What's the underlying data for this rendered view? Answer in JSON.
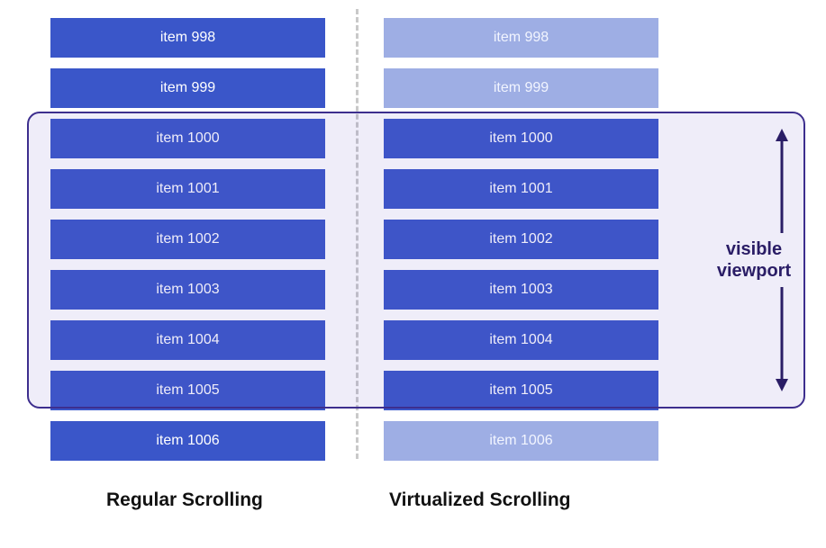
{
  "left_column": {
    "label": "Regular Scrolling",
    "items": [
      {
        "label": "item 998",
        "faded": false
      },
      {
        "label": "item 999",
        "faded": false
      },
      {
        "label": "item 1000",
        "faded": false
      },
      {
        "label": "item 1001",
        "faded": false
      },
      {
        "label": "item 1002",
        "faded": false
      },
      {
        "label": "item 1003",
        "faded": false
      },
      {
        "label": "item 1004",
        "faded": false
      },
      {
        "label": "item 1005",
        "faded": false
      },
      {
        "label": "item 1006",
        "faded": false
      }
    ]
  },
  "right_column": {
    "label": "Virtualized Scrolling",
    "items": [
      {
        "label": "item 998",
        "faded": true
      },
      {
        "label": "item 999",
        "faded": true
      },
      {
        "label": "item 1000",
        "faded": false
      },
      {
        "label": "item 1001",
        "faded": false
      },
      {
        "label": "item 1002",
        "faded": false
      },
      {
        "label": "item 1003",
        "faded": false
      },
      {
        "label": "item 1004",
        "faded": false
      },
      {
        "label": "item 1005",
        "faded": false
      },
      {
        "label": "item 1006",
        "faded": true
      }
    ]
  },
  "viewport": {
    "label_line1": "visible",
    "label_line2": "viewport"
  },
  "colors": {
    "item_solid": "#3a56c9",
    "item_faded": "#9eaee4",
    "viewport_border": "#3d2e8e",
    "viewport_fill": "rgba(100,80,200,0.10)",
    "divider": "#c9c9c9"
  }
}
